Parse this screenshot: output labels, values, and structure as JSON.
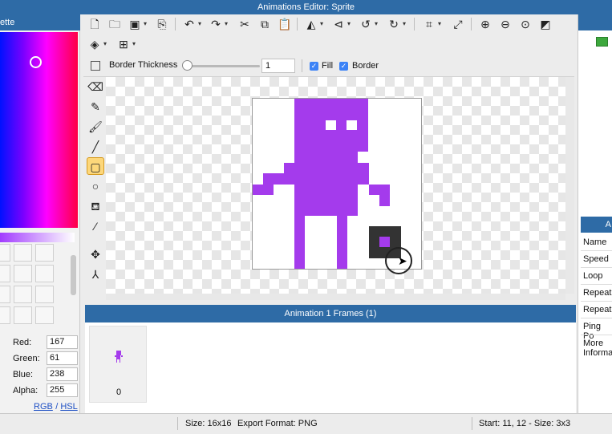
{
  "window": {
    "title": "Animations Editor: Sprite"
  },
  "palette": {
    "header": "ette",
    "red_label": "Red:",
    "red": "167",
    "green_label": "Green:",
    "green": "61",
    "blue_label": "Blue:",
    "blue": "238",
    "alpha_label": "Alpha:",
    "alpha": "255",
    "rgb_link": "RGB",
    "hsl_link": "HSL"
  },
  "toolbar": {
    "icons": [
      "new-file-icon",
      "open-folder-icon",
      "save-icon",
      "export-icon",
      "undo-icon",
      "redo-icon",
      "cut-icon",
      "copy-icon",
      "paste-icon",
      "flip-horizontal-icon",
      "flip-vertical-icon",
      "rotate-left-icon",
      "rotate-right-icon",
      "crop-icon",
      "resize-icon",
      "zoom-in-icon",
      "zoom-out-icon",
      "zoom-fit-icon",
      "invert-icon",
      "layers-icon",
      "grid-icon"
    ]
  },
  "options": {
    "border_thickness_label": "Border Thickness",
    "border_thickness_value": "1",
    "fill_label": "Fill",
    "border_label": "Border"
  },
  "tools": [
    "eraser-icon",
    "pencil-icon",
    "brush-icon",
    "line-icon",
    "rectangle-icon",
    "ellipse-icon",
    "fill-bucket-icon",
    "eyedropper-icon",
    "move-icon",
    "anchor-icon"
  ],
  "colors": {
    "sprite": "#a43bec",
    "accent": "#2e6ba6",
    "active_tool": "#fdd77a"
  },
  "frames": {
    "header": "Animation 1 Frames (1)",
    "items": [
      {
        "index": "0"
      }
    ]
  },
  "properties": {
    "header": "A",
    "rows": [
      "Name",
      "Speed",
      "Loop",
      "Repeat",
      "Repeat",
      "Ping Po",
      "More",
      "Informa"
    ]
  },
  "status": {
    "size": "Size: 16x16",
    "export_format": "Export Format: PNG",
    "selection": "Start: 11, 12 - Size: 3x3"
  }
}
